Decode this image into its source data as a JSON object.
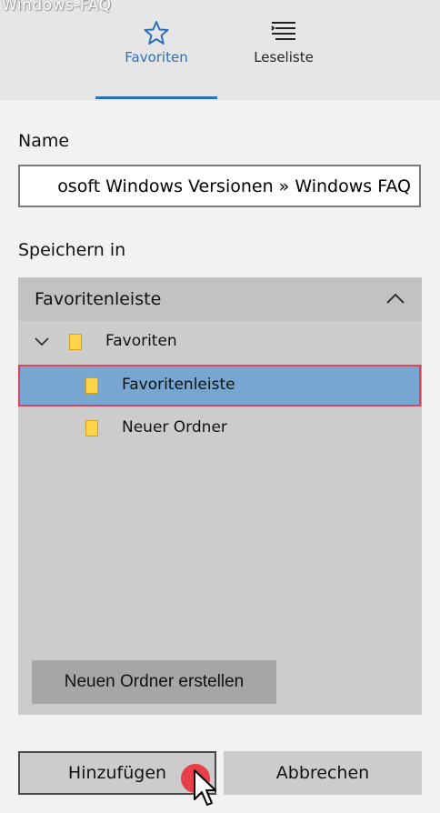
{
  "watermark": "Windows-FAQ",
  "tabs": [
    {
      "label": "Favoriten",
      "icon": "star-icon",
      "active": true
    },
    {
      "label": "Leseliste",
      "icon": "reading-list-icon",
      "active": false
    }
  ],
  "colors": {
    "accent": "#2d6fbe",
    "selection": "#77a7d1",
    "highlight_outline": "#d9455a",
    "click_marker": "#e8404a"
  },
  "name_label": "Name",
  "name_value": "osoft Windows Versionen » Windows FAQ",
  "save_in_label": "Speichern in",
  "folder_dropdown": {
    "selected": "Favoritenleiste",
    "tree": [
      {
        "label": "Favoriten",
        "expanded": true
      },
      {
        "label": "Favoritenleiste",
        "selected": true
      },
      {
        "label": "Neuer Ordner"
      }
    ]
  },
  "new_folder_button": "Neuen Ordner erstellen",
  "add_button": "Hinzufügen",
  "cancel_button": "Abbrechen"
}
